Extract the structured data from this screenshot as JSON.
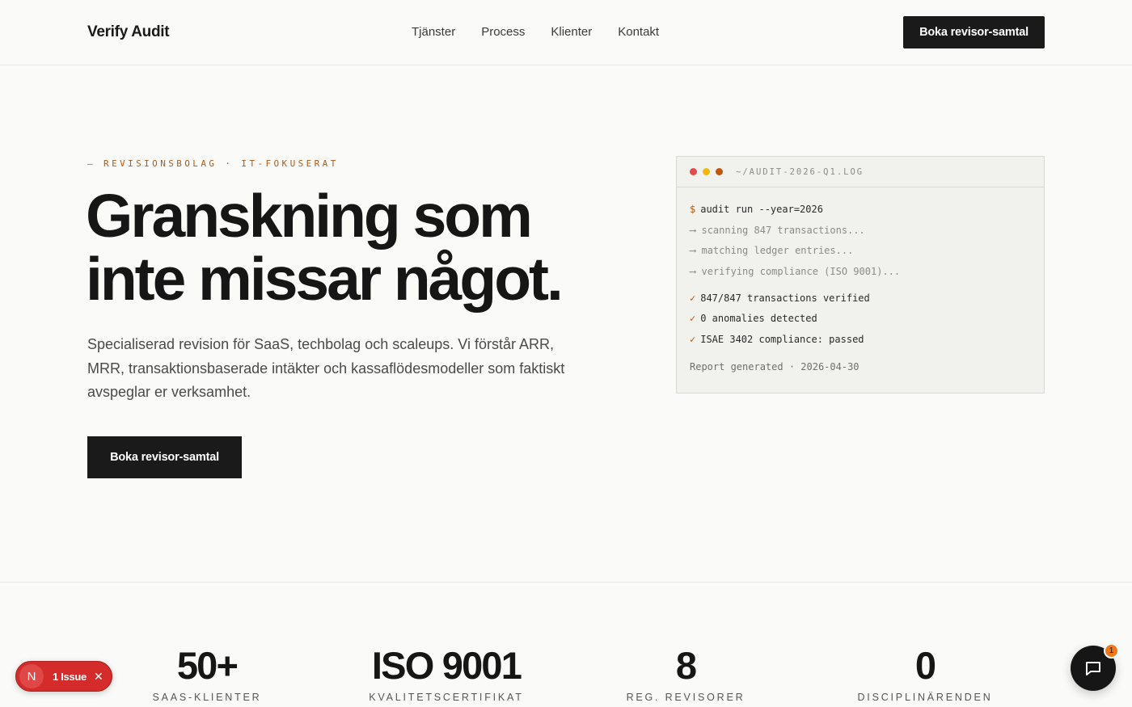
{
  "header": {
    "brand": "Verify Audit",
    "nav": [
      "Tjänster",
      "Process",
      "Klienter",
      "Kontakt"
    ],
    "cta": "Boka revisor-samtal"
  },
  "hero": {
    "eyebrow": "— REVISIONSBOLAG · IT-FOKUSERAT",
    "title_line1": "Granskning som",
    "title_line2": "inte missar något.",
    "description": "Specialiserad revision för SaaS, techbolag och scaleups. Vi förstår ARR, MRR, transaktionsbaserade intäkter och kassaflödesmodeller som faktiskt avspeglar er verksamhet.",
    "cta": "Boka revisor-samtal"
  },
  "terminal": {
    "filename": "~/AUDIT-2026-Q1.LOG",
    "prompt_symbol": "$",
    "command": "audit run --year=2026",
    "progress_arrow": "⟶",
    "progress": [
      "scanning 847 transactions...",
      "matching ledger entries...",
      "verifying compliance (ISO 9001)..."
    ],
    "check_symbol": "✓",
    "results": [
      "847/847 transactions verified",
      "0 anomalies detected",
      "ISAE 3402 compliance: passed"
    ],
    "report": "Report generated · 2026-04-30",
    "dot_colors": [
      "#e5484d",
      "#f5b70a",
      "#c2570c"
    ]
  },
  "stats": [
    {
      "value": "50+",
      "label": "SAAS-KLIENTER"
    },
    {
      "value": "ISO 9001",
      "label": "KVALITETSCERTIFIKAT"
    },
    {
      "value": "8",
      "label": "REG. REVISORER"
    },
    {
      "value": "0",
      "label": "DISCIPLINÄRENDEN"
    }
  ],
  "issue_badge": {
    "avatar": "N",
    "text": "1 Issue",
    "close": "✕"
  },
  "chat": {
    "badge": "1"
  },
  "colors": {
    "accent": "#b45a12",
    "dark": "#1a1a1a",
    "background": "#fafaf8"
  }
}
